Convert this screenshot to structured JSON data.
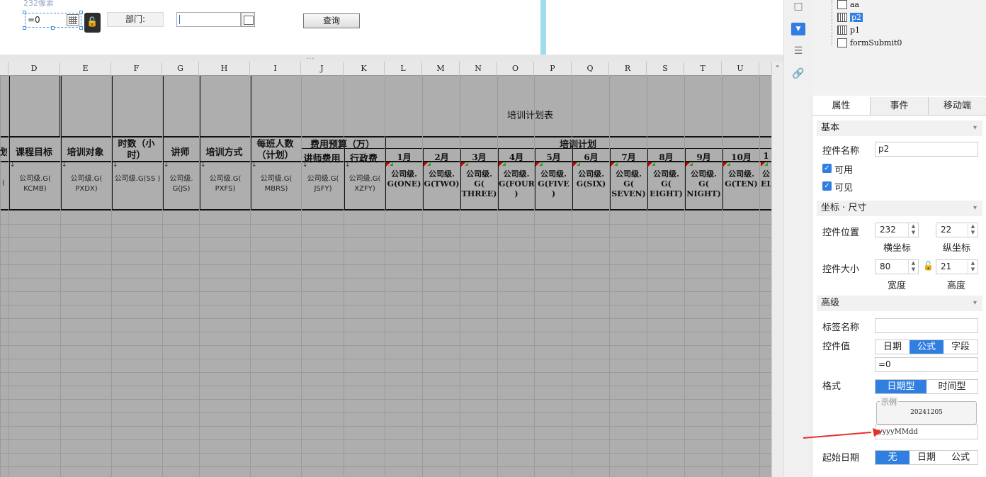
{
  "designer": {
    "pixel_hint": "232像素",
    "date_value": "=0",
    "dept_label": "部门:",
    "query_label": "查询",
    "splitter_dots": "..."
  },
  "sheet": {
    "columns": [
      "D",
      "E",
      "F",
      "G",
      "H",
      "I",
      "J",
      "K",
      "L",
      "M",
      "N",
      "O",
      "P",
      "Q",
      "R",
      "S",
      "T",
      "U"
    ],
    "table_title": "培训计划表",
    "budget_header": "费用预算（万）",
    "plan_header": "培训计划",
    "headers_left_partial": "划",
    "h_course_goal": "课程目标",
    "h_target": "培训对象",
    "h_hours": "时数（小时）",
    "h_teacher": "讲师",
    "h_method": "培训方式",
    "h_class_size": "每班人数（计划）",
    "h_teacher_fee": "讲师费用",
    "h_admin_fee": "行政费",
    "months": [
      "1月",
      "2月",
      "3月",
      "4月",
      "5月",
      "6月",
      "7月",
      "8月",
      "9月",
      "10月",
      "1"
    ],
    "field_left_partial": "(",
    "fields_plain": [
      "公司级.G( KCMB)",
      "公司级.G( PXDX)",
      "公司级.G(SS )",
      "公司级. G(JS)",
      "公司级.G( PXFS)",
      "公司级.G( MBRS)",
      "公司级.G( JSFY)",
      "公司级.G( XZFY)"
    ],
    "fields_months": [
      "公司级. G(ONE)",
      "公司级. G(TWO)",
      "公司级. G( THREE)",
      "公司级. G(FOUR )",
      "公司级. G(FIVE )",
      "公司级. G(SIX)",
      "公司级. G( SEVEN)",
      "公司级. G( EIGHT)",
      "公司级. G( NIGHT)",
      "公司级. G(TEN)",
      "公 EL"
    ]
  },
  "tree": {
    "items": [
      {
        "label": "aa",
        "icon": "label-icon"
      },
      {
        "label": "p2",
        "icon": "date-widget-icon",
        "selected": true
      },
      {
        "label": "p1",
        "icon": "date-widget-icon"
      },
      {
        "label": "formSubmit0",
        "icon": "submit-icon"
      }
    ]
  },
  "props": {
    "tabs": [
      "属性",
      "事件",
      "移动端"
    ],
    "sec_basic": "基本",
    "name_label": "控件名称",
    "name_value": "p2",
    "enabled_label": "可用",
    "visible_label": "可见",
    "sec_pos": "坐标 · 尺寸",
    "pos_label": "控件位置",
    "pos_x": "232",
    "pos_y": "22",
    "x_caption": "横坐标",
    "y_caption": "纵坐标",
    "size_label": "控件大小",
    "size_w": "80",
    "size_h": "21",
    "w_caption": "宽度",
    "h_caption": "高度",
    "sec_adv": "高级",
    "tagname_label": "标签名称",
    "tagname_value": "",
    "value_label": "控件值",
    "value_modes": [
      "日期",
      "公式",
      "字段"
    ],
    "value_mode_selected": "公式",
    "formula_value": "=0",
    "format_label": "格式",
    "format_modes": [
      "日期型",
      "时间型"
    ],
    "format_selected": "日期型",
    "sample_legend": "示例",
    "sample_value": "20241205",
    "format_pattern": "yyyyMMdd",
    "start_label": "起始日期",
    "start_modes": [
      "无",
      "日期",
      "公式"
    ],
    "start_selected": "无"
  },
  "colors": {
    "accent": "#2f7ee0",
    "arrow": "#e8302a",
    "cyan_strip": "#9fdde9"
  }
}
